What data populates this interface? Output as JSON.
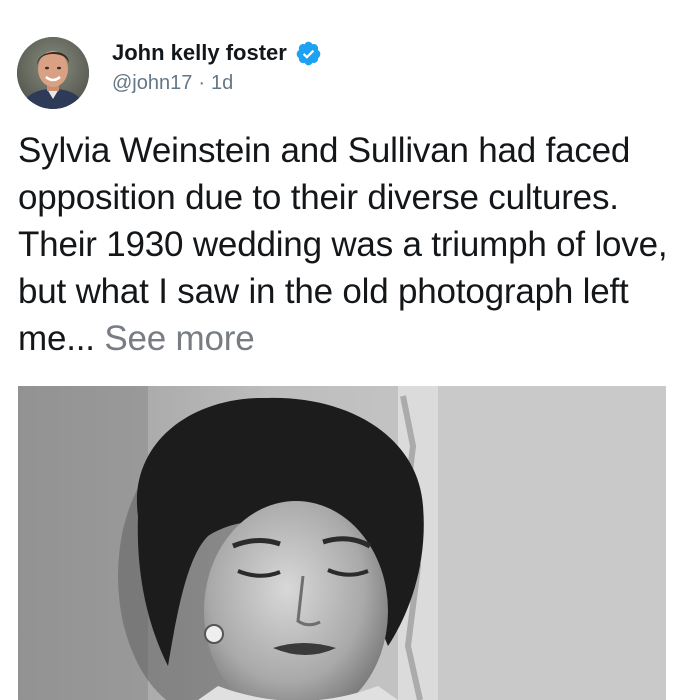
{
  "author": {
    "display_name": "John kelly foster",
    "handle": "@john17",
    "separator": "·",
    "timestamp": "1d",
    "verified": true,
    "avatar_icon": "man-portrait-avatar",
    "verified_icon": "verified-badge-icon",
    "verified_color": "#1da1f2"
  },
  "tweet": {
    "text": "Sylvia Weinstein and Sullivan had faced opposition due to their diverse cultures. Their 1930 wedding was a triumph of love, but what I saw in the old photograph left me... ",
    "see_more": "See more"
  },
  "media": {
    "type": "black-and-white-photo",
    "subject": "woman-portrait"
  },
  "colors": {
    "text": "#14171a",
    "secondary_text": "#657786",
    "see_more": "#777d83",
    "background": "#ffffff"
  }
}
